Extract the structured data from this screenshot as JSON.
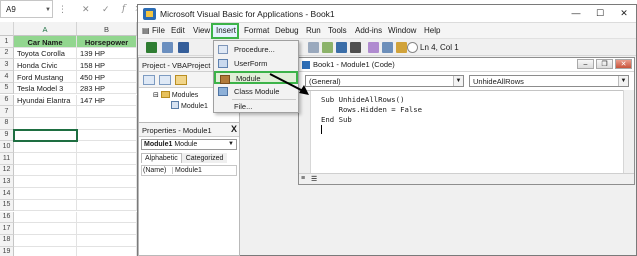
{
  "excel": {
    "name_box": "A9",
    "columns": [
      "A",
      "B"
    ],
    "rows": [
      "1",
      "2",
      "3",
      "4",
      "5",
      "6",
      "7",
      "8",
      "9",
      "10",
      "11",
      "12",
      "13",
      "14",
      "15",
      "16",
      "17",
      "18",
      "19"
    ],
    "table_header": [
      "Car Name",
      "Horsepower"
    ],
    "table_rows": [
      [
        "Toyota Corolla",
        "139 HP"
      ],
      [
        "Honda Civic",
        "158 HP"
      ],
      [
        "Ford Mustang",
        "450 HP"
      ],
      [
        "Tesla Model 3",
        "283 HP"
      ],
      [
        "Hyundai Elantra",
        "147 HP"
      ]
    ]
  },
  "vba": {
    "title": "Microsoft Visual Basic for Applications - Book1",
    "window_buttons": [
      "—",
      "☐",
      "✕"
    ],
    "menu": [
      "File",
      "Edit",
      "View",
      "Insert",
      "Format",
      "Debug",
      "Run",
      "Tools",
      "Add-ins",
      "Window",
      "Help"
    ],
    "status": "Ln 4, Col 1",
    "project_pane": {
      "title": "Project - VBAProject",
      "tree": [
        "Modules",
        "Module1"
      ]
    },
    "properties_pane": {
      "title": "Properties - Module1",
      "close": "X",
      "combo_name": "Module1",
      "combo_type": "Module",
      "tabs": [
        "Alphabetic",
        "Categorized"
      ],
      "row_key": "(Name)",
      "row_value": "Module1"
    },
    "insert_menu": [
      "Procedure...",
      "UserForm",
      "Module",
      "Class Module",
      "File..."
    ],
    "code_window": {
      "title": "Book1 - Module1 (Code)",
      "object_combo": "(General)",
      "proc_combo": "UnhideAllRows",
      "lines": [
        "Sub UnhideAllRows()",
        "    Rows.Hidden = False",
        "End Sub"
      ]
    }
  },
  "colors": {
    "header_fill": "#92d68f",
    "highlight": "#3cb349",
    "excel_selection": "#1e6e41"
  }
}
